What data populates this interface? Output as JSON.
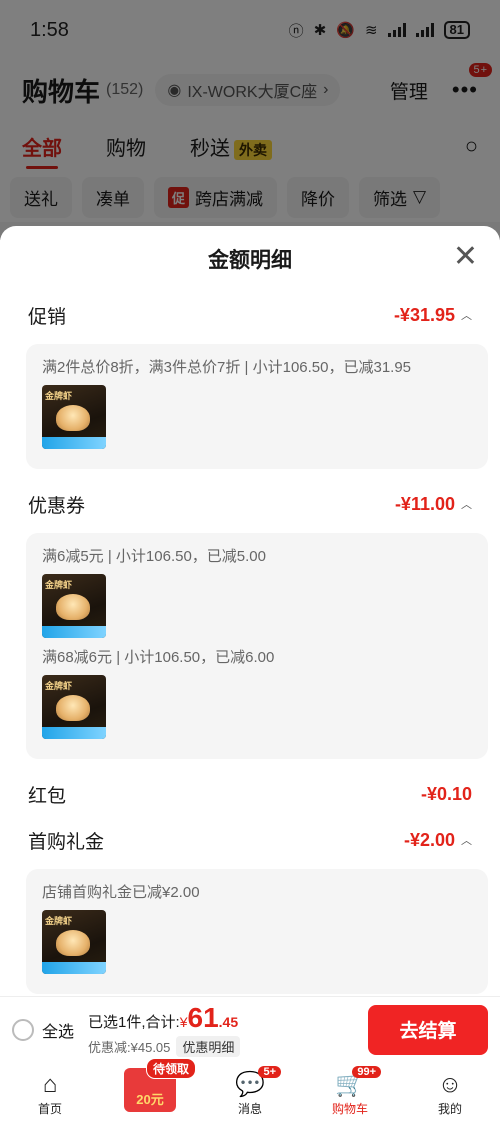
{
  "status": {
    "time": "1:58",
    "battery": "81"
  },
  "header": {
    "title": "购物车",
    "count": "(152)",
    "address": "IX-WORK大厦C座",
    "manage": "管理",
    "more_badge": "5+"
  },
  "tabs": {
    "all": "全部",
    "shop": "购物",
    "express": "秒送",
    "express_tag": "外卖"
  },
  "chips": {
    "gift": "送礼",
    "bundle": "凑单",
    "promo_tag": "促",
    "promo": "跨店满减",
    "price_drop": "降价",
    "filter": "筛选"
  },
  "sheet": {
    "title": "金额明细",
    "promotion": {
      "label": "促销",
      "amount": "-¥31.95",
      "detail": "满2件总价8折，满3件总价7折 | 小计106.50，已减31.95"
    },
    "coupon": {
      "label": "优惠券",
      "amount": "-¥11.00",
      "detail1": "满6减5元 | 小计106.50，已减5.00",
      "detail2": "满68减6元 | 小计106.50，已减6.00"
    },
    "redpacket": {
      "label": "红包",
      "amount": "-¥0.10"
    },
    "firstbuy": {
      "label": "首购礼金",
      "amount": "-¥2.00",
      "detail": "店铺首购礼金已减¥2.00"
    },
    "product_thumb_text": "金牌虾"
  },
  "checkout": {
    "select_all": "全选",
    "selected": "已选1件,合计:",
    "yen": "¥",
    "total_int": "61",
    "total_dec": ".45",
    "discount": "优惠减:¥45.05",
    "detail_btn": "优惠明细",
    "pay": "去结算"
  },
  "nav": {
    "home": "首页",
    "coupon_tag": "待领取",
    "coupon_text": "20元",
    "messages": "消息",
    "messages_badge": "5+",
    "cart": "购物车",
    "cart_badge": "99+",
    "mine": "我的"
  }
}
